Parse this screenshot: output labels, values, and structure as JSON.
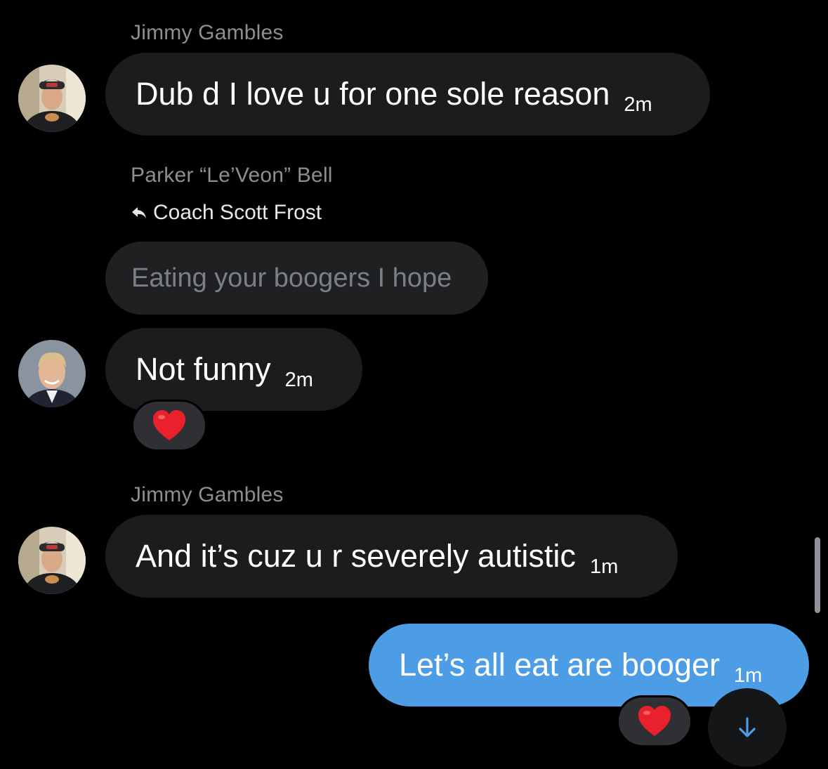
{
  "messages": [
    {
      "sender": "Jimmy Gambles",
      "text": "Dub d I love u for one sole reason",
      "time": "2m",
      "avatar": "avatar-jimmy-gambles"
    },
    {
      "sender": "Parker “Le’Veon” Bell",
      "reply_to": "Coach Scott Frost",
      "quoted_text": "Eating your boogers I hope",
      "text": "Not funny",
      "time": "2m",
      "avatar": "avatar-parker-bell",
      "reaction": "red-heart"
    },
    {
      "sender": "Jimmy Gambles",
      "text": "And it’s cuz u r severely autistic",
      "time": "1m",
      "avatar": "avatar-jimmy-gambles"
    },
    {
      "sender": "",
      "text": "Let’s all eat are booger",
      "time": "1m",
      "mine": true,
      "reaction": "red-heart"
    }
  ],
  "icons": {
    "reply": "reply-arrow-icon",
    "reaction": "red-heart-icon",
    "scroll_down": "arrow-down-icon"
  },
  "colors": {
    "background": "#000000",
    "bubble_incoming": "#1b1c1e",
    "bubble_outgoing": "#4d9de6",
    "sender_name": "#8b8f94",
    "quoted_text": "#7c8086",
    "heart": "#e8212d"
  }
}
